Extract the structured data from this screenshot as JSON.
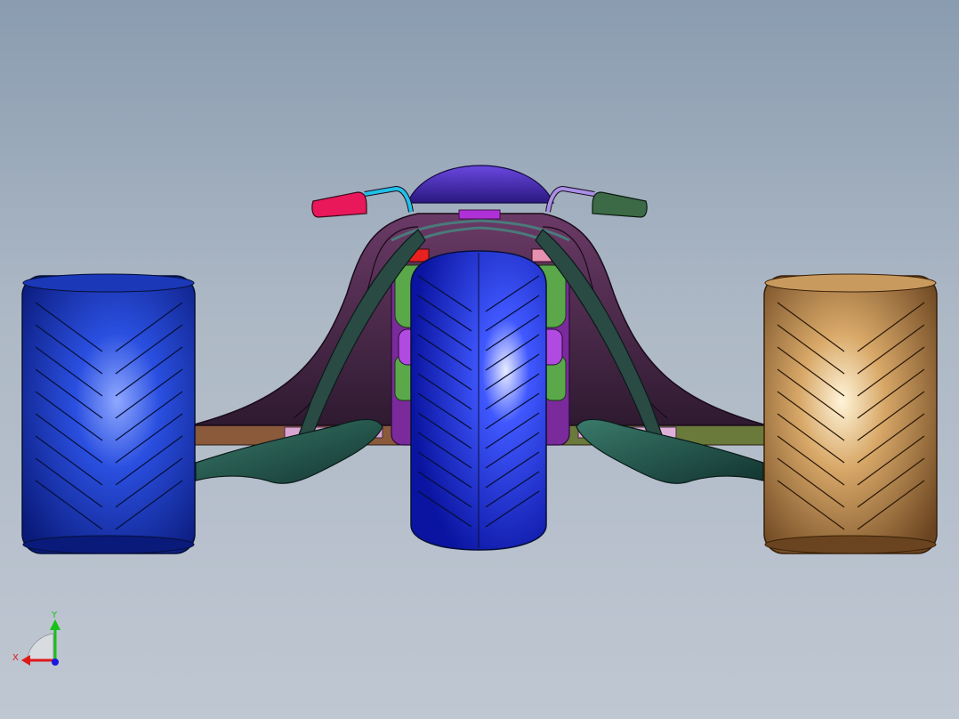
{
  "viewport": {
    "background_top": "#8a9cb0",
    "background_bottom": "#bfc7d2"
  },
  "model": {
    "parts": [
      {
        "name": "left-rear-tire",
        "color": "#1e3ec8"
      },
      {
        "name": "front-tire",
        "color": "#1428e6"
      },
      {
        "name": "right-rear-tire",
        "color": "#c89a5e"
      },
      {
        "name": "body-shell",
        "color": "#4a2a48"
      },
      {
        "name": "fairing-dome",
        "color": "#4a2aa8"
      },
      {
        "name": "left-mirror",
        "color": "#e8185a"
      },
      {
        "name": "right-mirror",
        "color": "#3c6a46"
      },
      {
        "name": "front-wing",
        "color": "#1e4a44"
      }
    ]
  },
  "triad": {
    "x_label": "X",
    "y_label": "Y",
    "x_color": "#e01818",
    "y_color": "#18c018",
    "z_color": "#1818e0"
  }
}
